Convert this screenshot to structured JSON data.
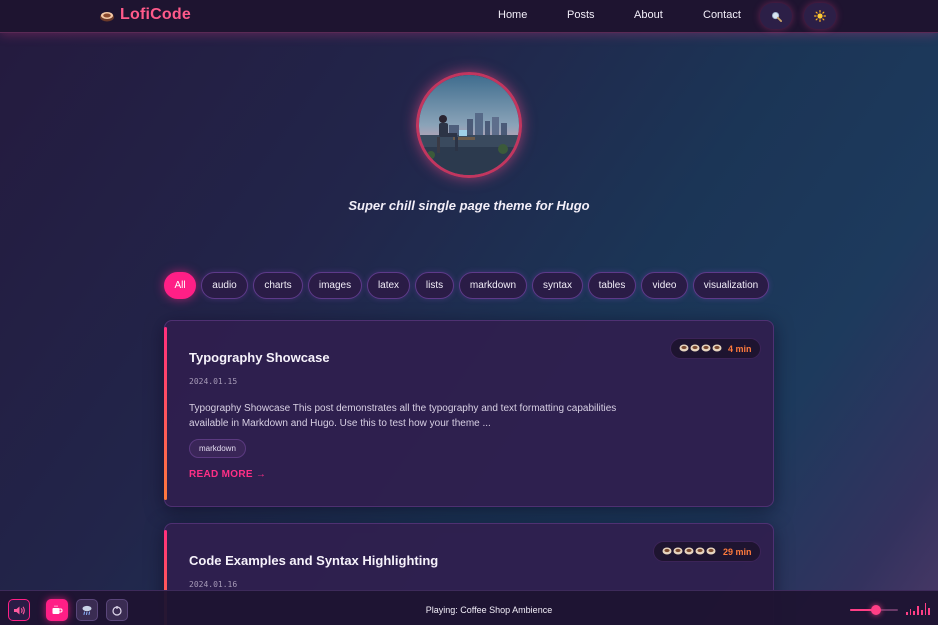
{
  "header": {
    "brand": "LofiCode",
    "nav": [
      "Home",
      "Posts",
      "About",
      "Contact"
    ]
  },
  "hero": {
    "tagline": "Super chill single page theme for Hugo"
  },
  "filters": [
    "All",
    "audio",
    "charts",
    "images",
    "latex",
    "lists",
    "markdown",
    "syntax",
    "tables",
    "video",
    "visualization"
  ],
  "filters_active": "All",
  "posts": [
    {
      "title": "Typography Showcase",
      "date": "2024.01.15",
      "excerpt": "Typography Showcase This post demonstrates all the typography and text formatting capabilities available in Markdown and Hugo. Use this to test how your theme ...",
      "tag": "markdown",
      "read_more": "READ MORE →",
      "read_time": "4 min",
      "coffee_cups": 4
    },
    {
      "title": "Code Examples and Syntax Highlighting",
      "date": "2024.01.16",
      "read_time": "29 min",
      "coffee_cups": 5
    }
  ],
  "player": {
    "now_playing": "Playing: Coffee Shop Ambience",
    "volume": 0.55
  },
  "colors": {
    "accent": "#ff1f86",
    "brand": "#ff5a8a",
    "read_time": "#ff7a3d",
    "header_bg": "#1e1430"
  }
}
